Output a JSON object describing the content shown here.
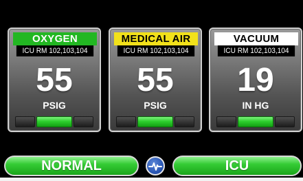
{
  "panels": [
    {
      "gas": "OXYGEN",
      "room": "ICU RM 102,103,104",
      "value": "55",
      "unit": "PSIG",
      "label_bg": "#22b722",
      "label_fg": "#ffffff",
      "level": 0.5
    },
    {
      "gas": "MEDICAL AIR",
      "room": "ICU RM 102,103,104",
      "value": "55",
      "unit": "PSIG",
      "label_bg": "#f2e11a",
      "label_fg": "#000000",
      "level": 0.5
    },
    {
      "gas": "VACUUM",
      "room": "ICU RM 102,103,104",
      "value": "19",
      "unit": "IN HG",
      "label_bg": "#ffffff",
      "label_fg": "#000000",
      "level": 0.5
    }
  ],
  "footer": {
    "status_label": "NORMAL",
    "area_label": "ICU",
    "logo_icon": "heartbeat-icon",
    "status_color": "#2fc82f"
  }
}
